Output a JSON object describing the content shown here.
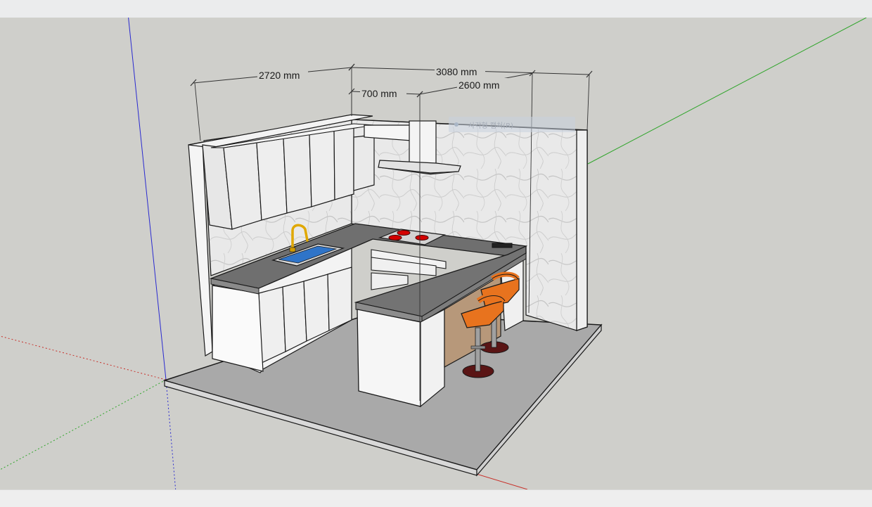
{
  "app": {
    "toolbar": {},
    "status_bar": {}
  },
  "viewport": {
    "dimensions": {
      "width_2720": "2720 mm",
      "width_3080": "3080 mm",
      "depth_700": "700 mm",
      "depth_2600": "2600 mm"
    },
    "inference_tooltip": {
      "text": "사각형 캡처(R)",
      "icon": "inference-dot-icon"
    },
    "axis_colors": {
      "red": "#c8302a",
      "green": "#2fa52a",
      "blue": "#2a2ad0"
    },
    "materials": {
      "countertop": "#6f6f6f",
      "cabinet": "#f4f4f4",
      "floor": "#a8a8a8",
      "stool_seat": "#e8731e",
      "stool_base": "#5a1515",
      "faucet": "#e0a800",
      "sink_water": "#2f74c8",
      "island_wood": "#b7987a"
    }
  }
}
